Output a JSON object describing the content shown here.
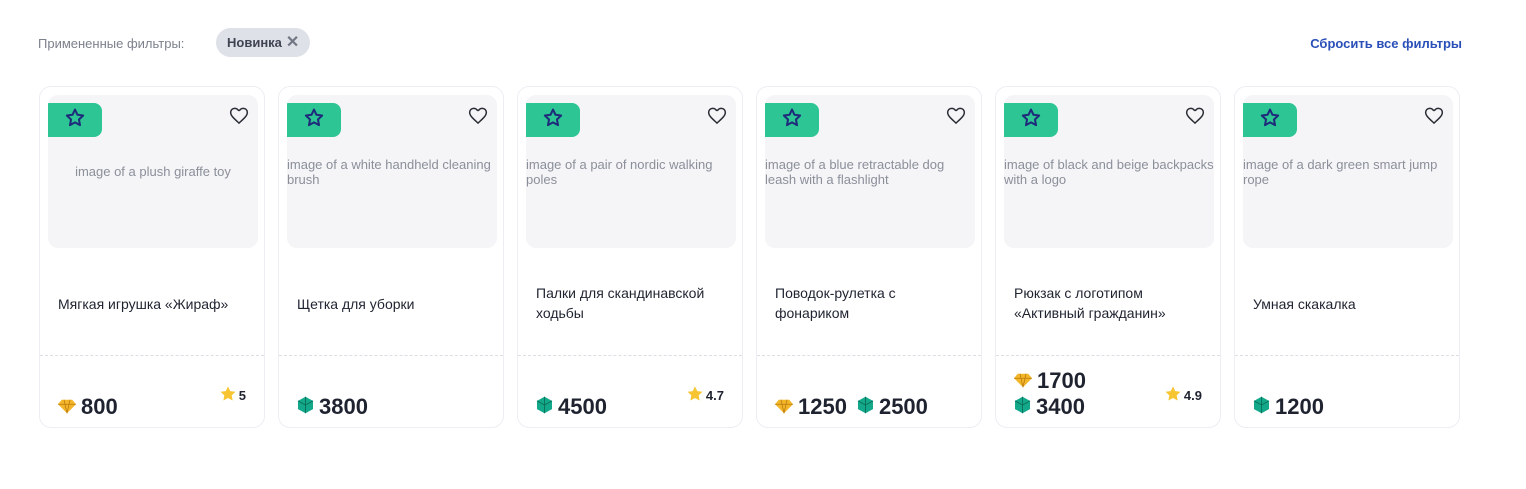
{
  "filters": {
    "label": "Примененные фильтры:",
    "chips": [
      {
        "label": "Новинка"
      }
    ],
    "reset_label": "Сбросить все фильтры"
  },
  "products": [
    {
      "title": "Мягкая игрушка «Жираф»",
      "image": "image of a plush giraffe toy",
      "prices": [
        {
          "currency": "diamond",
          "amount": "800"
        }
      ],
      "rating": "5"
    },
    {
      "title": "Щетка для уборки",
      "image": "image of a white handheld cleaning brush",
      "prices": [
        {
          "currency": "gem",
          "amount": "3800"
        }
      ],
      "rating": ""
    },
    {
      "title": "Палки для скандинавской ходьбы",
      "image": "image of a pair of nordic walking poles",
      "prices": [
        {
          "currency": "gem",
          "amount": "4500"
        }
      ],
      "rating": "4.7"
    },
    {
      "title": "Поводок-рулетка с фонариком",
      "image": "image of a blue retractable dog leash with a flashlight",
      "prices": [
        {
          "currency": "diamond",
          "amount": "1250"
        },
        {
          "currency": "gem",
          "amount": "2500"
        }
      ],
      "rating": ""
    },
    {
      "title": "Рюкзак с логотипом «Активный гражданин»",
      "image": "image of black and beige backpacks with a logo",
      "prices": [
        {
          "currency": "diamond",
          "amount": "1700"
        },
        {
          "currency": "gem",
          "amount": "3400"
        }
      ],
      "rating": "4.9"
    },
    {
      "title": "Умная скакалка",
      "image": "image of a dark green smart jump rope",
      "prices": [
        {
          "currency": "gem",
          "amount": "1200"
        }
      ],
      "rating": ""
    }
  ],
  "colors": {
    "accent": "#2ec594",
    "link": "#2a4fb8",
    "star": "#1d2b7a",
    "rating_star": "#f6c531",
    "diamond": "#f3b62a",
    "gem": "#13a889"
  },
  "icons": {
    "badge": "star-outline-icon",
    "favorite": "heart-outline-icon",
    "diamond": "diamond-icon",
    "gem": "gem-icon",
    "rating": "rating-star-icon",
    "chip_remove": "close-icon"
  }
}
